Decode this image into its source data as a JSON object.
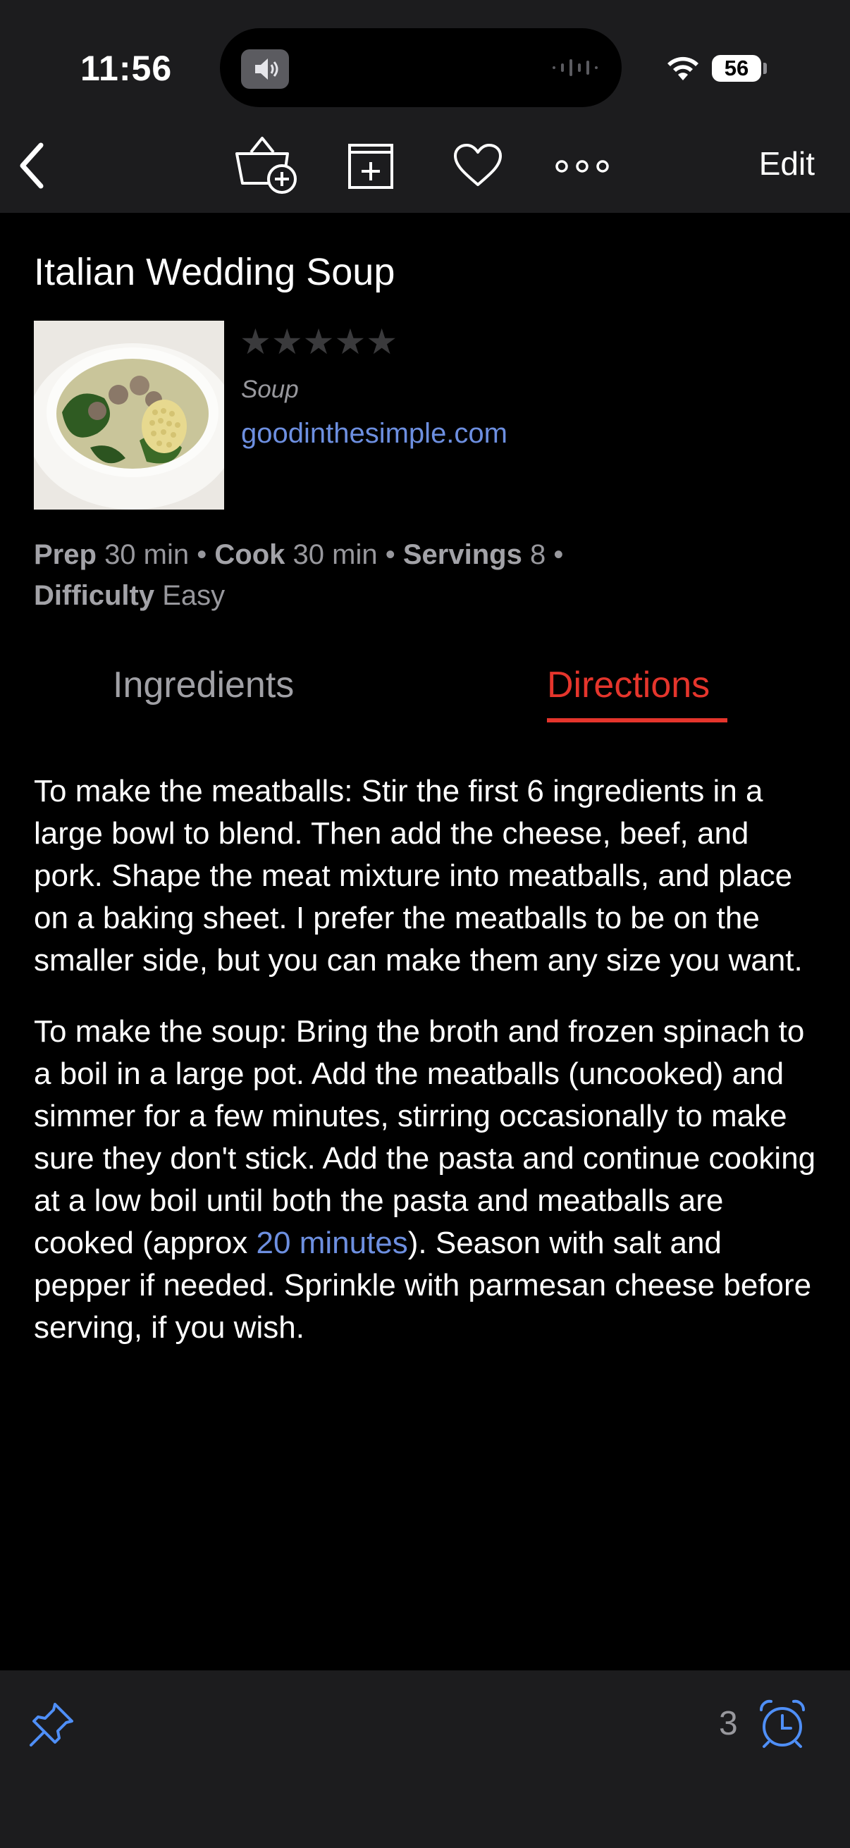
{
  "status_bar": {
    "time": "11:56",
    "battery": "56"
  },
  "nav": {
    "edit_label": "Edit"
  },
  "recipe": {
    "title": "Italian Wedding Soup",
    "rating_display": "★★★★★",
    "rating": 0,
    "category": "Soup",
    "source": "goodinthesimple.com",
    "meta": {
      "prep_label": "Prep",
      "prep_value": "30 min",
      "cook_label": "Cook",
      "cook_value": "30 min",
      "servings_label": "Servings",
      "servings_value": "8",
      "difficulty_label": "Difficulty",
      "difficulty_value": "Easy",
      "separator": "•"
    }
  },
  "tabs": {
    "ingredients": "Ingredients",
    "directions": "Directions",
    "active": "directions"
  },
  "directions": {
    "paragraph_1": "To make the meatballs: Stir the first 6 ingredients in a large bowl to blend. Then add the cheese, beef, and pork. Shape the meat mixture into meatballs, and place on a baking sheet. I prefer the meatballs to be on the smaller side, but you can make them any size you want.",
    "paragraph_2_before": "To make the soup: Bring the broth and frozen spinach to a boil in a large pot. Add the meatballs (uncooked) and simmer for a few minutes, stirring occasionally to make sure they don't stick. Add the pasta and continue cooking at a low boil until both the pasta and meatballs are cooked (approx ",
    "paragraph_2_timer": "20 minutes",
    "paragraph_2_after": "). Season with salt and pepper if needed. Sprinkle with parmesan cheese before serving, if you wish."
  },
  "bottom_bar": {
    "timer_count": "3"
  },
  "colors": {
    "accent_red": "#e5352c",
    "link_blue": "#6d8fe0",
    "bar_background": "#1c1c1e"
  },
  "icons": [
    "back-chevron-icon",
    "basket-add-icon",
    "add-to-plan-icon",
    "heart-icon",
    "more-icon",
    "pin-icon",
    "alarm-clock-icon",
    "wifi-icon",
    "speaker-icon"
  ]
}
